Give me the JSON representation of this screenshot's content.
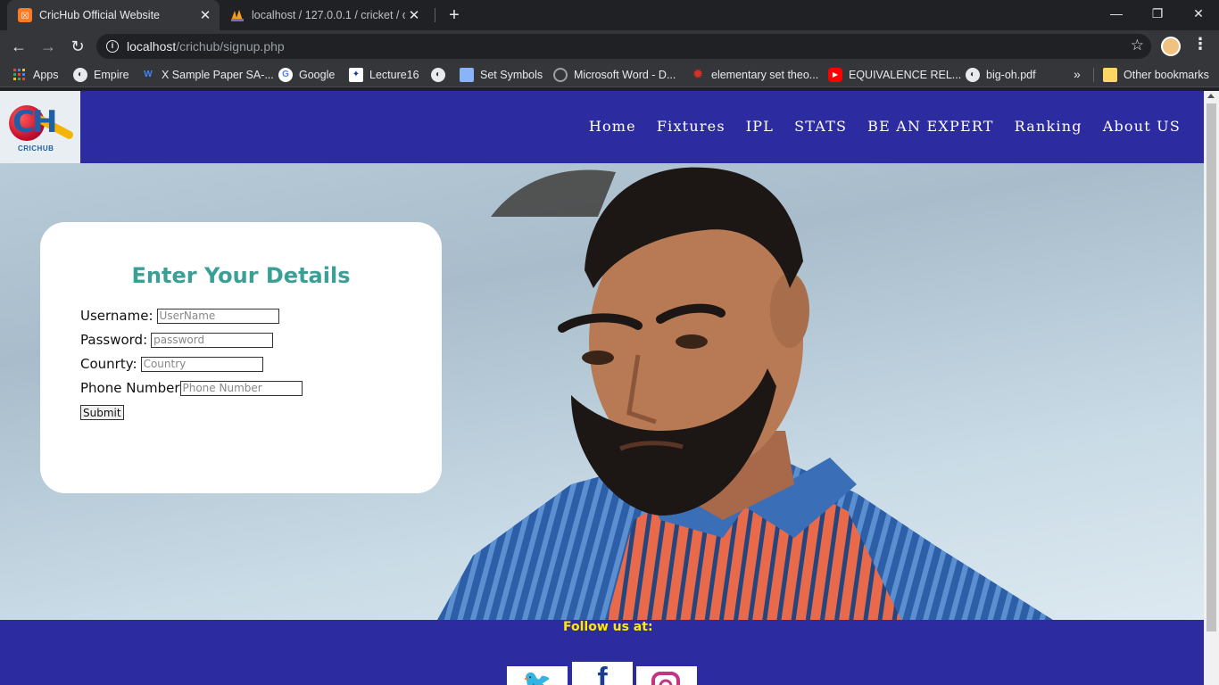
{
  "browser": {
    "tabs": [
      {
        "title": "CricHub Official Website",
        "active": true
      },
      {
        "title": "localhost / 127.0.0.1 / cricket / oc",
        "active": false
      }
    ],
    "url_host": "localhost",
    "url_path": "/crichub/signup.php",
    "bookmarks": [
      {
        "label": "Apps",
        "icon": "apps-grid-icon",
        "color": "#ea4335"
      },
      {
        "label": "Empire",
        "icon": "globe-icon",
        "color": "#5f6368"
      },
      {
        "label": "X Sample Paper SA-...",
        "icon": "w-icon",
        "color": "#4285f4"
      },
      {
        "label": "Google",
        "icon": "google-icon",
        "color": "#ffffff"
      },
      {
        "label": "Lecture16",
        "icon": "lecture-icon",
        "color": "#1a3d8f"
      },
      {
        "label": "",
        "icon": "globe-icon",
        "color": "#5f6368"
      },
      {
        "label": "Set Symbols",
        "icon": "image-icon",
        "color": "#8ab4f8"
      },
      {
        "label": "Microsoft Word - D...",
        "icon": "loading-icon",
        "color": "#5f6368"
      },
      {
        "label": "elementary set theo...",
        "icon": "gear-red-icon",
        "color": "#d93025"
      },
      {
        "label": "EQUIVALENCE REL...",
        "icon": "youtube-icon",
        "color": "#ff0000"
      },
      {
        "label": "big-oh.pdf",
        "icon": "globe-icon",
        "color": "#5f6368"
      }
    ],
    "other_bookmarks": "Other bookmarks"
  },
  "site": {
    "brand": "CRICHUB",
    "nav": [
      "Home",
      "Fixtures",
      "IPL",
      "STATS",
      "BE AN EXPERT",
      "Ranking",
      "About US"
    ],
    "form": {
      "title": "Enter Your Details",
      "username_label": "Username:",
      "username_placeholder": "UserName",
      "password_label": "Password:",
      "password_placeholder": "password",
      "country_label": "Counrty:",
      "country_placeholder": "Country",
      "phone_label": "Phone Number",
      "phone_placeholder": "Phone Number",
      "submit_label": "Submit"
    },
    "footer": {
      "follow_text": "Follow us at:",
      "socials": [
        "twitter-icon",
        "facebook-icon",
        "instagram-icon"
      ]
    }
  },
  "colors": {
    "header_bg": "#2c2ba0",
    "title_teal": "#3aa096",
    "follow_yellow": "#ffea00"
  }
}
